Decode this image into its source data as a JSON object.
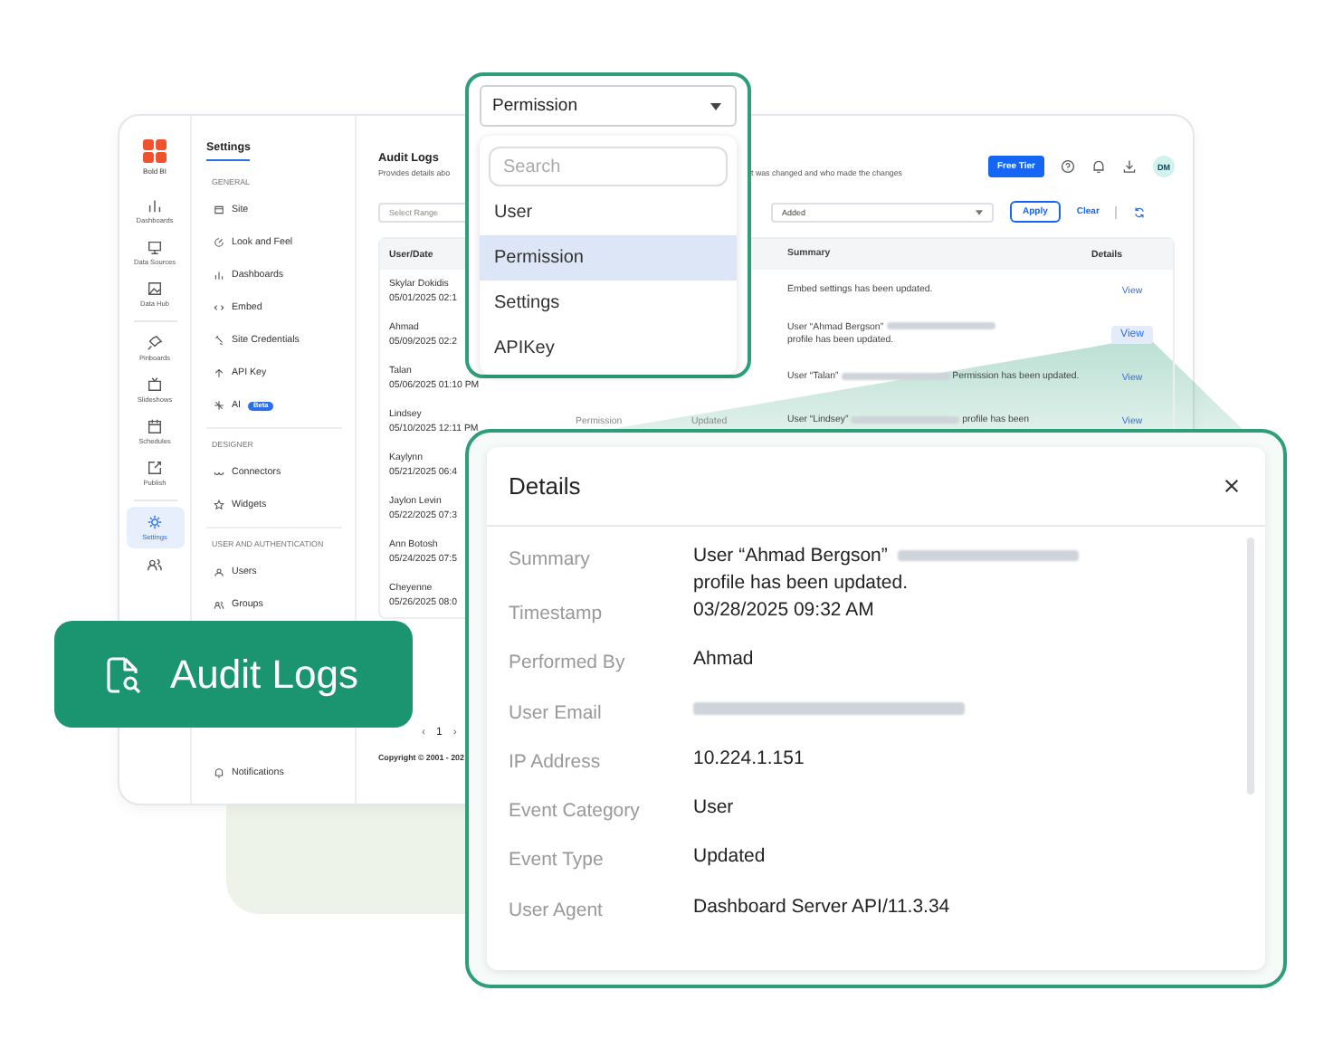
{
  "rail": {
    "logo": "Bold BI",
    "items": [
      {
        "label": "Dashboards",
        "selected": false
      },
      {
        "label": "Data Sources",
        "selected": false
      },
      {
        "label": "Data Hub",
        "selected": false
      },
      {
        "label": "Pinboards",
        "selected": false
      },
      {
        "label": "Slideshows",
        "selected": false
      },
      {
        "label": "Schedules",
        "selected": false
      },
      {
        "label": "Publish",
        "selected": false
      },
      {
        "label": "Settings",
        "selected": true
      },
      {
        "selected": false
      }
    ]
  },
  "settings_nav": {
    "title": "Settings",
    "sections": [
      {
        "heading": "GENERAL",
        "items": [
          {
            "label": "Site"
          },
          {
            "label": "Look and Feel"
          },
          {
            "label": "Dashboards"
          },
          {
            "label": "Embed"
          },
          {
            "label": "Site Credentials"
          },
          {
            "label": "API Key"
          },
          {
            "label": "AI",
            "badge": "Beta"
          }
        ]
      },
      {
        "heading": "DESIGNER",
        "items": [
          {
            "label": "Connectors"
          },
          {
            "label": "Widgets"
          }
        ]
      },
      {
        "heading": "USER AND AUTHENTICATION",
        "items": [
          {
            "label": "Users"
          },
          {
            "label": "Groups"
          }
        ]
      }
    ],
    "footer_item": "Notifications"
  },
  "audit_logs": {
    "title": "Audit Logs",
    "subtitle_left": "Provides details abo",
    "subtitle_right": "t was changed and who made the changes",
    "plan_button": "Free Tier",
    "avatar": "DM",
    "range_placeholder": "Select Range",
    "type_value": "Added",
    "apply": "Apply",
    "clear": "Clear",
    "columns": {
      "user_date": "User/Date",
      "summary": "Summary",
      "details": "Details"
    },
    "rows": [
      {
        "name": "Skylar Dokidis",
        "date": "05/01/2025 02:1",
        "summary_start": "Embed settings has been updated.",
        "action": "View",
        "selected": false
      },
      {
        "name": "Ahmad",
        "date": "05/09/2025 02:2",
        "summary_start": "User “Ahmad Bergson”",
        "redacted": true,
        "summary_end": "profile has been updated.",
        "action": "View",
        "selected": true
      },
      {
        "name": "Talan",
        "date": "05/06/2025 01:10 PM",
        "summary_start": "User “Talan”",
        "redacted": true,
        "summary_end": "Permission has been updated.",
        "action": "View",
        "selected": false
      },
      {
        "name": "Lindsey",
        "date": "05/10/2025 12:11 PM",
        "category": "Permission",
        "type": "Updated",
        "summary_start": "User “Lindsey”",
        "redacted": true,
        "summary_end": "profile has been",
        "action": "View",
        "selected": false
      },
      {
        "name": "Kaylynn",
        "date": "05/21/2025 06:4"
      },
      {
        "name": "Jaylon Levin",
        "date": "05/22/2025 07:3"
      },
      {
        "name": "Ann Botosh",
        "date": "05/24/2025 07:5"
      },
      {
        "name": "Cheyenne",
        "date": "05/26/2025 08:0"
      }
    ],
    "pagination": {
      "prev": "‹",
      "page": "1",
      "next": "›"
    },
    "copyright": "Copyright © 2001 - 202"
  },
  "filter_dropdown": {
    "value": "Permission",
    "search_placeholder": "Search",
    "options": [
      {
        "label": "User",
        "selected": false
      },
      {
        "label": "Permission",
        "selected": true
      },
      {
        "label": "Settings",
        "selected": false
      },
      {
        "label": "APIKey",
        "selected": false
      }
    ]
  },
  "details_dialog": {
    "title": "Details",
    "fields": [
      {
        "label": "Summary",
        "value": "User “Ahmad Bergson”",
        "redacted": true,
        "value_end": "profile has been updated."
      },
      {
        "label": "Timestamp",
        "value": "03/28/2025 09:32 AM"
      },
      {
        "label": "Performed By",
        "value": "Ahmad"
      },
      {
        "label": "User Email",
        "redacted": true
      },
      {
        "label": "IP Address",
        "value": "10.224.1.151"
      },
      {
        "label": "Event Category",
        "value": "User"
      },
      {
        "label": "Event Type",
        "value": "Updated"
      },
      {
        "label": "User Agent",
        "value": "Dashboard Server API/11.3.34"
      }
    ]
  },
  "feature_badge": {
    "label": "Audit Logs"
  }
}
